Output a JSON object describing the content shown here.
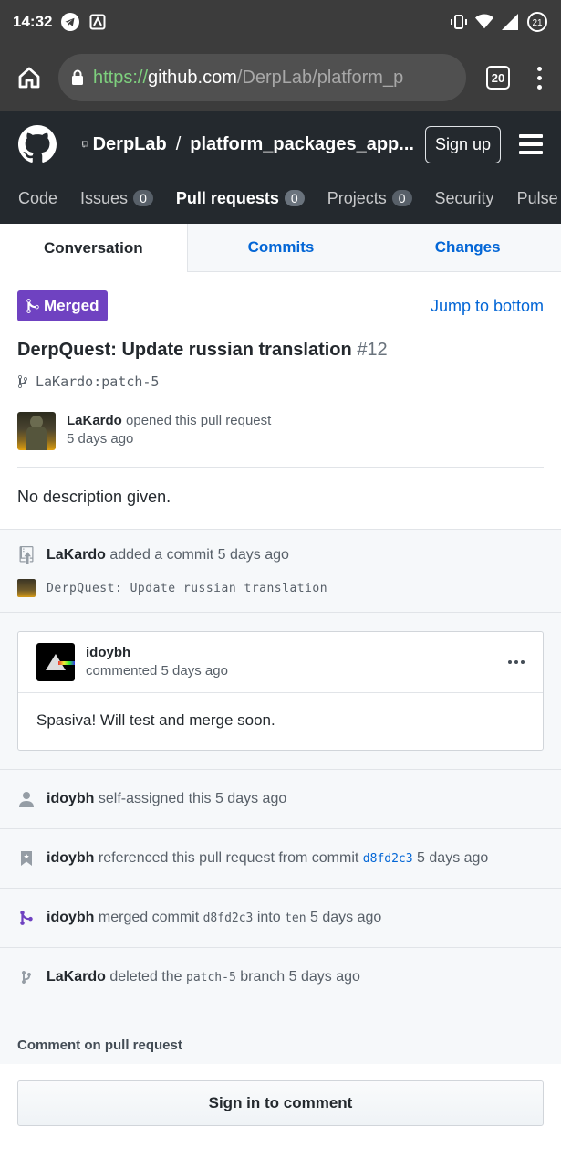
{
  "status_bar": {
    "time": "14:32",
    "battery": "21",
    "icons": [
      "telegram-icon",
      "screenshot-icon",
      "vibrate-icon",
      "wifi-icon",
      "signal-icon",
      "battery-icon"
    ]
  },
  "browser": {
    "url_scheme": "https://",
    "url_host": "github.com",
    "url_path": "/DerpLab/platform_p",
    "tab_count": "20"
  },
  "header": {
    "owner": "DerpLab",
    "separator": "/",
    "repo": "platform_packages_app...",
    "signup_label": "Sign up"
  },
  "nav": [
    {
      "label": "Code",
      "count": null
    },
    {
      "label": "Issues",
      "count": "0"
    },
    {
      "label": "Pull requests",
      "count": "0",
      "active": true
    },
    {
      "label": "Projects",
      "count": "0"
    },
    {
      "label": "Security",
      "count": null
    },
    {
      "label": "Pulse",
      "count": null
    }
  ],
  "tabs": {
    "conversation": "Conversation",
    "commits": "Commits",
    "changes": "Changes"
  },
  "pr": {
    "state_label": "Merged",
    "jump_label": "Jump to bottom",
    "title": "DerpQuest: Update russian translation",
    "number": "#12",
    "branch": "LaKardo:patch-5",
    "author": "LaKardo",
    "opened_text": "opened this pull request",
    "opened_when": "5 days ago",
    "description": "No description given."
  },
  "timeline": {
    "commit_event": {
      "author": "LaKardo",
      "text": "added a commit 5 days ago",
      "message": "DerpQuest: Update russian translation"
    },
    "comment": {
      "author": "idoybh",
      "meta": "commented 5 days ago",
      "body": "Spasiva! Will test and merge soon."
    },
    "self_assigned": {
      "author": "idoybh",
      "text": "self-assigned this 5 days ago"
    },
    "referenced": {
      "author": "idoybh",
      "text_before": "referenced this pull request from commit",
      "sha": "d8fd2c3",
      "when": "5 days ago"
    },
    "merged": {
      "author": "idoybh",
      "text_before": "merged commit",
      "sha": "d8fd2c3",
      "text_mid": "into",
      "branch": "ten",
      "when": "5 days ago"
    },
    "deleted": {
      "author": "LaKardo",
      "text_before": "deleted the",
      "branch": "patch-5",
      "text_after": "branch",
      "when": "5 days ago"
    }
  },
  "footer": {
    "comment_heading": "Comment on pull request",
    "signin_label": "Sign in to comment"
  },
  "colors": {
    "merged": "#6f42c1",
    "link": "#0366d6",
    "header_bg": "#24292e"
  }
}
